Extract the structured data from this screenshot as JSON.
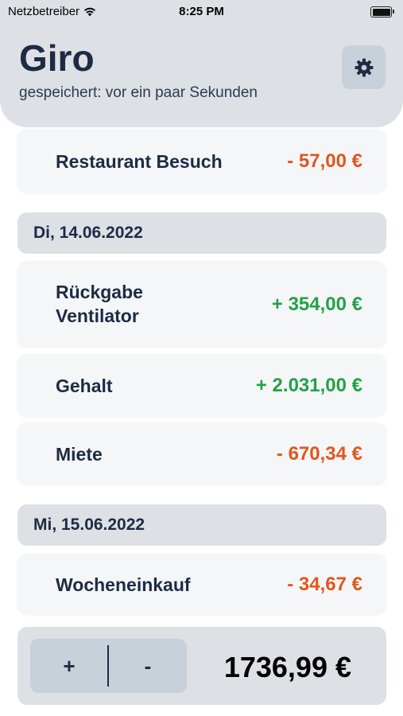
{
  "status_bar": {
    "carrier": "Netzbetreiber",
    "time": "8:25 PM"
  },
  "header": {
    "title": "Giro",
    "subtitle": "gespeichert: vor ein paar Sekunden",
    "settings_icon": "gear-icon"
  },
  "entries": [
    {
      "label": "Restaurant Besuch",
      "amount": "- 57,00 €",
      "type": "negative"
    },
    {
      "date": "Di, 14.06.2022"
    },
    {
      "label": "Rückgabe\nVentilator",
      "amount": "+ 354,00 €",
      "type": "positive"
    },
    {
      "label": "Gehalt",
      "amount": "+ 2.031,00 €",
      "type": "positive"
    },
    {
      "label": "Miete",
      "amount": "- 670,34 €",
      "type": "negative"
    },
    {
      "date": "Mi, 15.06.2022"
    },
    {
      "label": "Wocheneinkauf",
      "amount": "- 34,67 €",
      "type": "negative"
    }
  ],
  "bottom": {
    "plus_label": "+",
    "minus_label": "-",
    "balance": "1736,99 €"
  },
  "colors": {
    "negative": "#e0561d",
    "positive": "#22a245",
    "primary_text": "#1d2b44",
    "header_bg": "#dde1e6"
  }
}
